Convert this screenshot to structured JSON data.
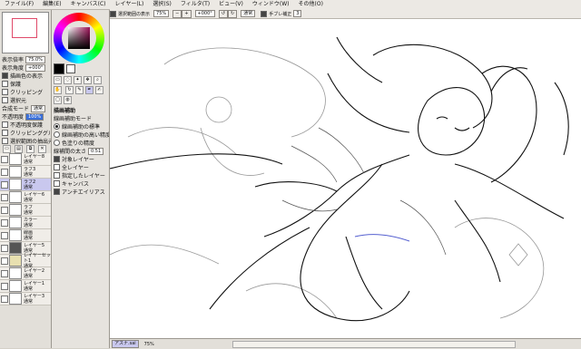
{
  "menu": [
    "ファイル(F)",
    "編集(E)",
    "キャンバス(C)",
    "レイヤー(L)",
    "選択(S)",
    "フィルタ(T)",
    "ビュー(V)",
    "ウィンドウ(W)",
    "その他(O)"
  ],
  "toolbar": {
    "selection_label": "選択範囲の表示",
    "zoom_value": "75%",
    "angle_value": "+000°",
    "blend_label": "通常",
    "stabilizer_label": "手ブレ補正",
    "stabilizer_value": "3"
  },
  "navigator": {
    "zoom_label": "表示倍率",
    "zoom_value": "75.0%",
    "angle_label": "表示角度",
    "angle_value": "+000°"
  },
  "layer_props": {
    "options": [
      "描画色の表示",
      "保護",
      "クリッピング",
      "選択元"
    ],
    "blend_mode_label": "合成モード",
    "blend_mode_value": "通常",
    "opacity_label": "不透明度",
    "opacity_value": "100%",
    "protect_options": [
      "不透明度保護",
      "クリッピンググループ",
      "選択範囲の抽出元に指定"
    ]
  },
  "tool_options": {
    "header": "描画補助",
    "brush_mode_label": "線画補助モード",
    "radios": [
      "線画補助の標準",
      "線画補助の高い精度",
      "色塗りの精度"
    ],
    "size_label": "線補間の太さ",
    "size_value": "0.51",
    "checks": [
      "対象レイヤー",
      "全レイヤー",
      "指定したレイヤー",
      "キャンバス"
    ],
    "antialias_label": "アンチエイリアス"
  },
  "layers": [
    {
      "name": "レイヤー8",
      "mode": "通常",
      "pct": "100%"
    },
    {
      "name": "ラフ3",
      "mode": "通常",
      "pct": "100%"
    },
    {
      "name": "ラフ2",
      "mode": "通常",
      "pct": "100%"
    },
    {
      "name": "レイヤー6",
      "mode": "通常",
      "pct": "100%"
    },
    {
      "name": "ラフ",
      "mode": "通常",
      "pct": "100%"
    },
    {
      "name": "カラー",
      "mode": "通常",
      "pct": "100%"
    },
    {
      "name": "線画",
      "mode": "通常",
      "pct": "100%"
    },
    {
      "name": "レイヤー5",
      "mode": "通常",
      "pct": "100%"
    },
    {
      "name": "レイヤーセット1",
      "mode": "通常",
      "pct": "100%"
    },
    {
      "name": "レイヤー2",
      "mode": "通常",
      "pct": "100%"
    },
    {
      "name": "レイヤー1",
      "mode": "通常",
      "pct": "100%"
    },
    {
      "name": "レイヤー3",
      "mode": "通常",
      "pct": "100%"
    }
  ],
  "status": {
    "file_tab": "アスナ.sai",
    "zoom": "75%"
  },
  "colors": {
    "panel": "#e2dfd9",
    "selected_layer": "#c9c8ee",
    "accent": "#3a6fd8"
  }
}
